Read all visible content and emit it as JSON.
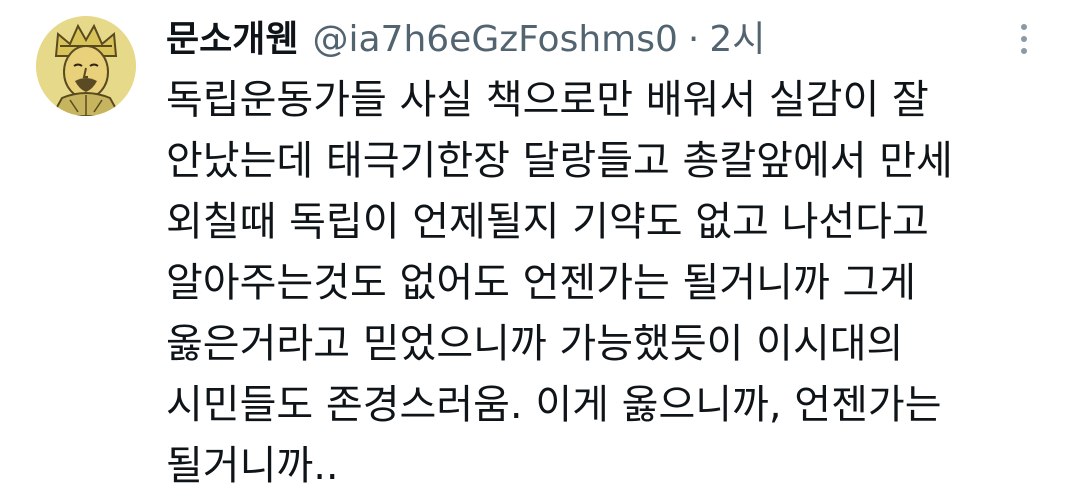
{
  "author": {
    "display_name": "문소개웬",
    "handle": "@ia7h6eGzFoshms0",
    "separator": "·",
    "time": "2시"
  },
  "icons": {
    "avatar": "avatar-portrait-icon",
    "more": "more-vertical-icon"
  },
  "colors": {
    "text": "#0f1419",
    "secondary_text": "#536471",
    "background": "#ffffff",
    "avatar_background": "#e7d98a"
  },
  "tweet": {
    "lines": [
      "독립운동가들 사실 책으로만 배워서 실감이 잘",
      "안났는데 태극기한장 달랑들고 총칼앞에서 만세",
      "외칠때 독립이 언제될지 기약도 없고 나선다고",
      "알아주는것도 없어도 언젠가는 될거니까 그게",
      "옳은거라고 믿었으니까 가능했듯이 이시대의",
      "시민들도 존경스러움. 이게 옳으니까, 언젠가는",
      "될거니까.."
    ]
  }
}
